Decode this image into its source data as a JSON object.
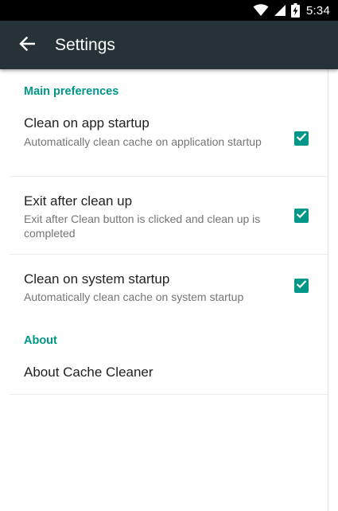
{
  "status_bar": {
    "time": "5:34",
    "icons": [
      "wifi-icon",
      "signal-icon",
      "battery-charging-icon"
    ]
  },
  "app_bar": {
    "back_icon": "arrow-back-icon",
    "title": "Settings"
  },
  "sections": {
    "main": {
      "header": "Main preferences",
      "items": [
        {
          "title": "Clean on app startup",
          "summary": "Automatically clean cache on application startup",
          "checked": true
        },
        {
          "title": "Exit after clean up",
          "summary": "Exit after Clean button is clicked and clean up is completed",
          "checked": true
        },
        {
          "title": "Clean on system startup",
          "summary": "Automatically clean cache on system startup",
          "checked": true
        }
      ]
    },
    "about": {
      "header": "About",
      "items": [
        {
          "title": "About Cache Cleaner"
        }
      ]
    }
  },
  "colors": {
    "accent": "#009688",
    "app_bar": "#263238",
    "status_bar": "#000000"
  }
}
